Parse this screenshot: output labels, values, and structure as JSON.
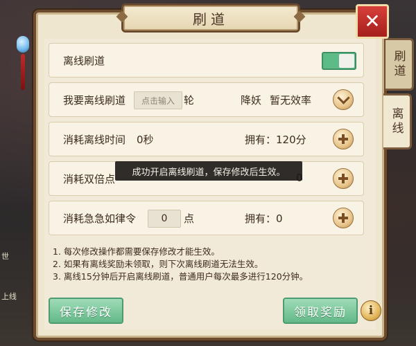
{
  "window": {
    "title": "刷道",
    "close_label": "✕"
  },
  "tabs": [
    {
      "label": "刷道",
      "active": false
    },
    {
      "label": "离线",
      "active": true
    }
  ],
  "rows": {
    "offline": {
      "label": "离线刷道",
      "toggle_on": true
    },
    "rounds": {
      "label": "我要离线刷道",
      "input_placeholder": "点击输入",
      "unit": "轮",
      "effect_label": "降妖",
      "effect_value": "暂无效率"
    },
    "time": {
      "label": "消耗离线时间",
      "value": "0秒",
      "owned": "拥有：120分"
    },
    "double": {
      "label": "消耗双倍点",
      "owned_partial": "0"
    },
    "urgent": {
      "label": "消耗急急如律令",
      "value": "0",
      "unit": "点",
      "owned": "拥有：0"
    }
  },
  "tooltip": "成功开启离线刷道，保存修改后生效。",
  "notes": [
    "1. 每次修改操作都需要保存修改才能生效。",
    "2. 如果有离线奖励未领取，则下次离线刷道无法生效。",
    "3. 离线15分钟后开启离线刷道，普通用户每次最多进行120分钟。"
  ],
  "buttons": {
    "save": "保存修改",
    "claim": "领取奖励",
    "info": "i"
  },
  "scene": {
    "left_text_1": "世",
    "left_text_2": "上线"
  },
  "colors": {
    "toggle_on": "#5dbb87",
    "panel": "#efe6cf",
    "close": "#c7302c"
  }
}
